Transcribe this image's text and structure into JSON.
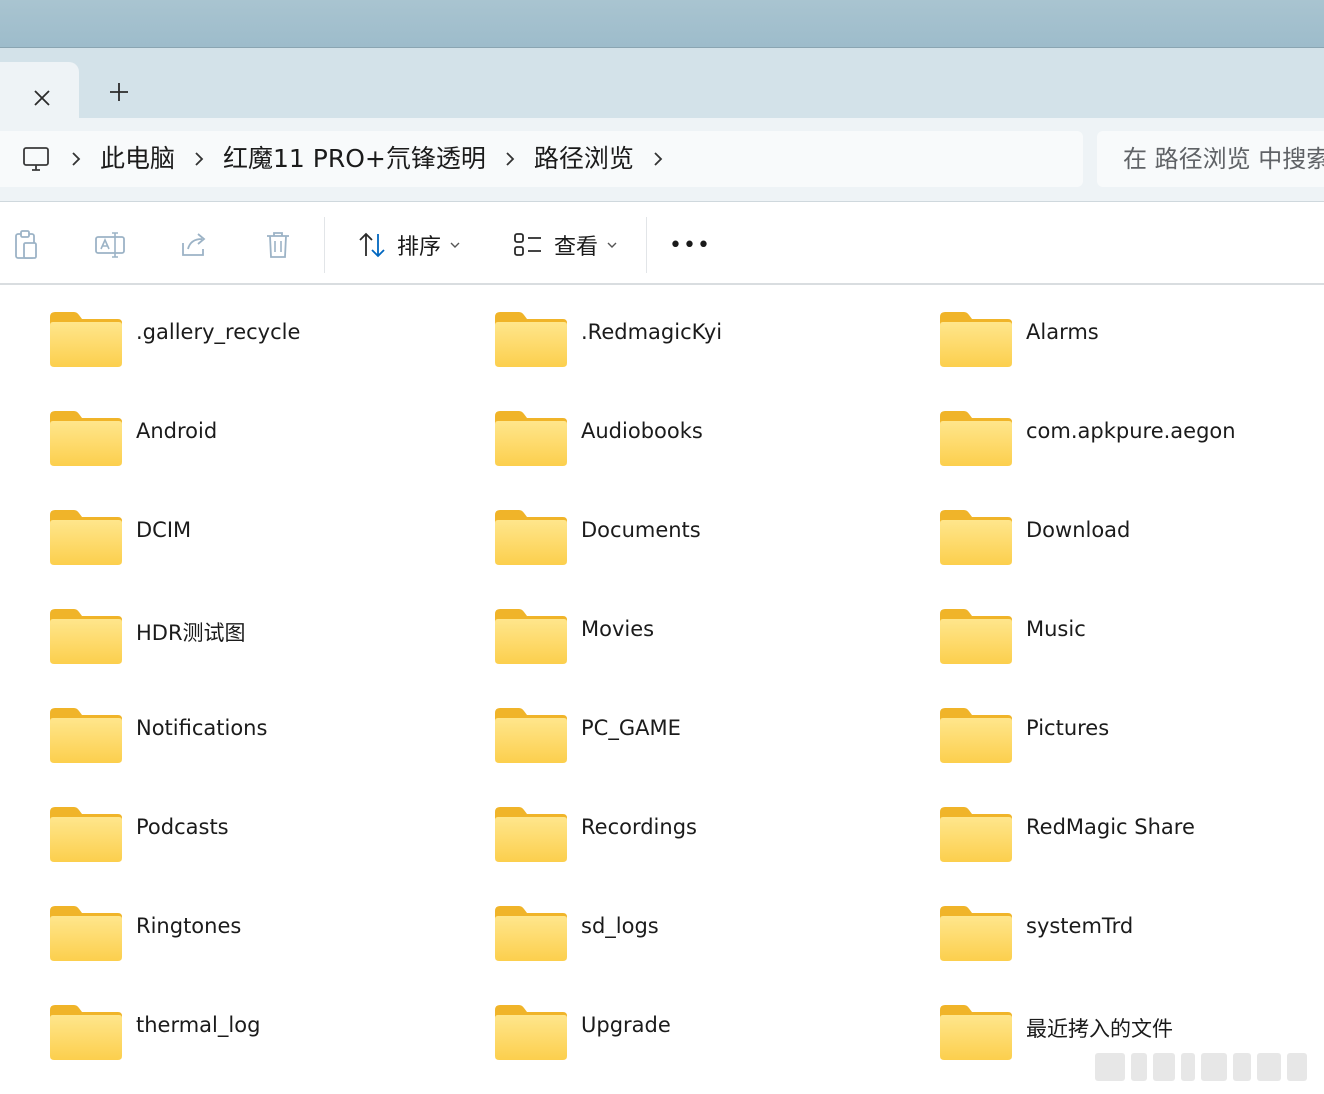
{
  "tabs": {
    "close_symbol": "✕",
    "new_tab_symbol": "+"
  },
  "breadcrumb": {
    "items": [
      "此电脑",
      "红魔11 PRO+氘锋透明",
      "路径浏览"
    ],
    "separator": "›"
  },
  "search": {
    "placeholder": "在 路径浏览 中搜索"
  },
  "toolbar": {
    "sort_label": "排序",
    "view_label": "查看",
    "more_symbol": "•••"
  },
  "folders": [
    [
      ".gallery_recycle",
      ".RedmagicKyi",
      "Alarms"
    ],
    [
      "Android",
      "Audiobooks",
      "com.apkpure.aegon"
    ],
    [
      "DCIM",
      "Documents",
      "Download"
    ],
    [
      "HDR测试图",
      "Movies",
      "Music"
    ],
    [
      "Notifications",
      "PC_GAME",
      "Pictures"
    ],
    [
      "Podcasts",
      "Recordings",
      "RedMagic Share"
    ],
    [
      "Ringtones",
      "sd_logs",
      "systemTrd"
    ],
    [
      "thermal_log",
      "Upgrade",
      "最近拷入的文件"
    ]
  ],
  "colors": {
    "folder_back": "#f0b429",
    "folder_front": "#fdd869",
    "accent": "#0067c0"
  }
}
